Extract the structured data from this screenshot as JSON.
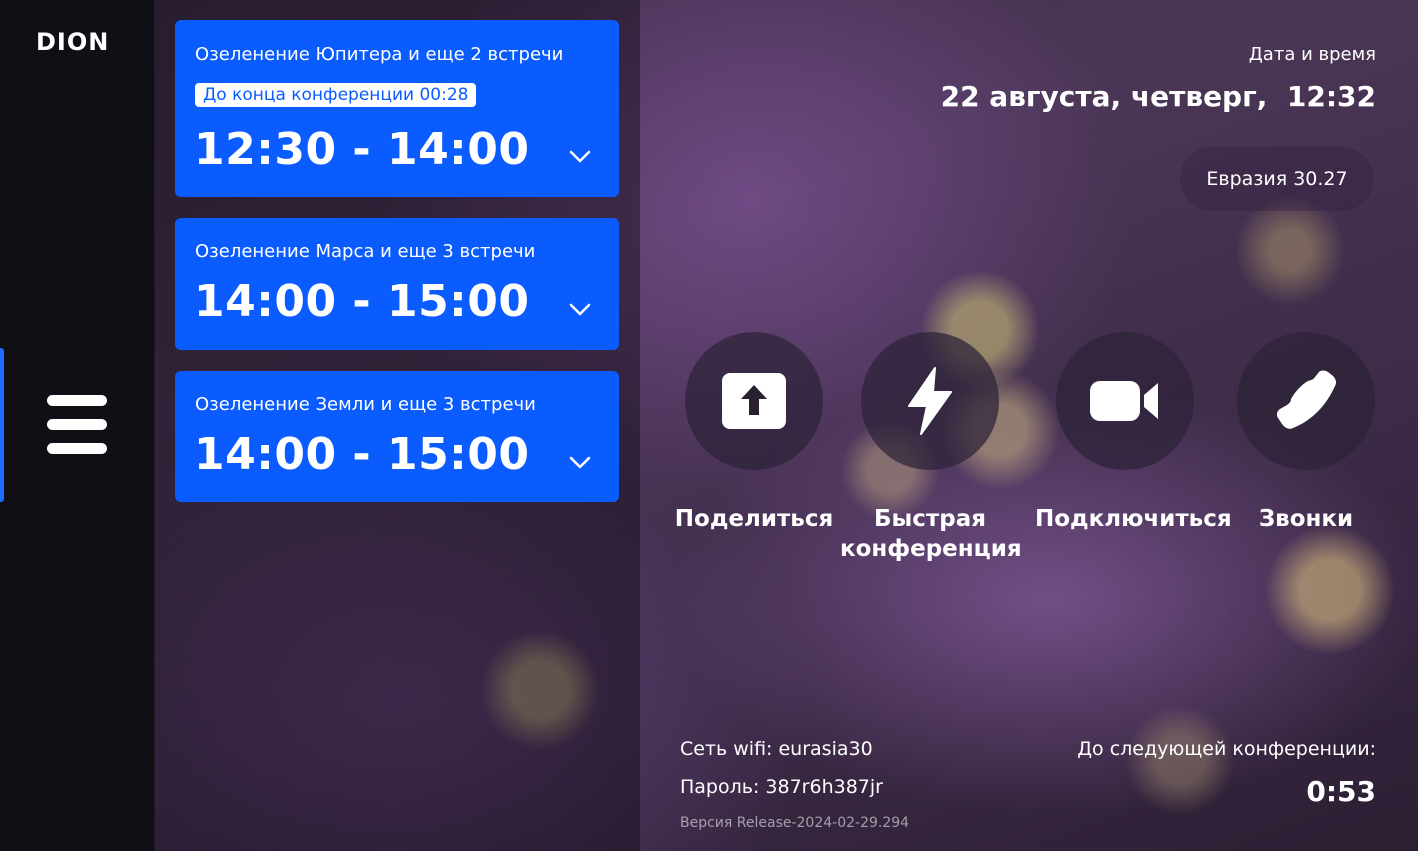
{
  "sidebar": {
    "logo": "DION",
    "menu_icon": "menu-icon"
  },
  "meetings": [
    {
      "title": "Озеленение Юпитера и еще 2 встречи",
      "badge": "До конца конференции 00:28",
      "time": "12:30 - 14:00"
    },
    {
      "title": "Озеленение Марса и еще 3 встречи",
      "time": "14:00 - 15:00"
    },
    {
      "title": "Озеленение Земли и еще 3 встречи",
      "time": "14:00 - 15:00"
    }
  ],
  "datetime": {
    "label": "Дата и время",
    "value": "22 августа, четверг,  12:32"
  },
  "room": "Евразия 30.27",
  "actions": {
    "share": {
      "label": "Поделиться",
      "icon": "upload-icon"
    },
    "quick": {
      "label": "Быстрая конференция",
      "icon": "lightning-icon"
    },
    "connect": {
      "label": "Подключиться",
      "icon": "video-camera-icon"
    },
    "calls": {
      "label": "Звонки",
      "icon": "phone-icon"
    }
  },
  "network": {
    "wifi": "Сеть wifi: eurasia30",
    "password": "Пароль: 387r6h387jr",
    "version": "Версия Release-2024-02-29.294"
  },
  "next_conference": {
    "label": "До следующей конференции:",
    "value": "0:53"
  },
  "colors": {
    "accent": "#0a5cff",
    "sidebar_active": "#1f6dff"
  }
}
